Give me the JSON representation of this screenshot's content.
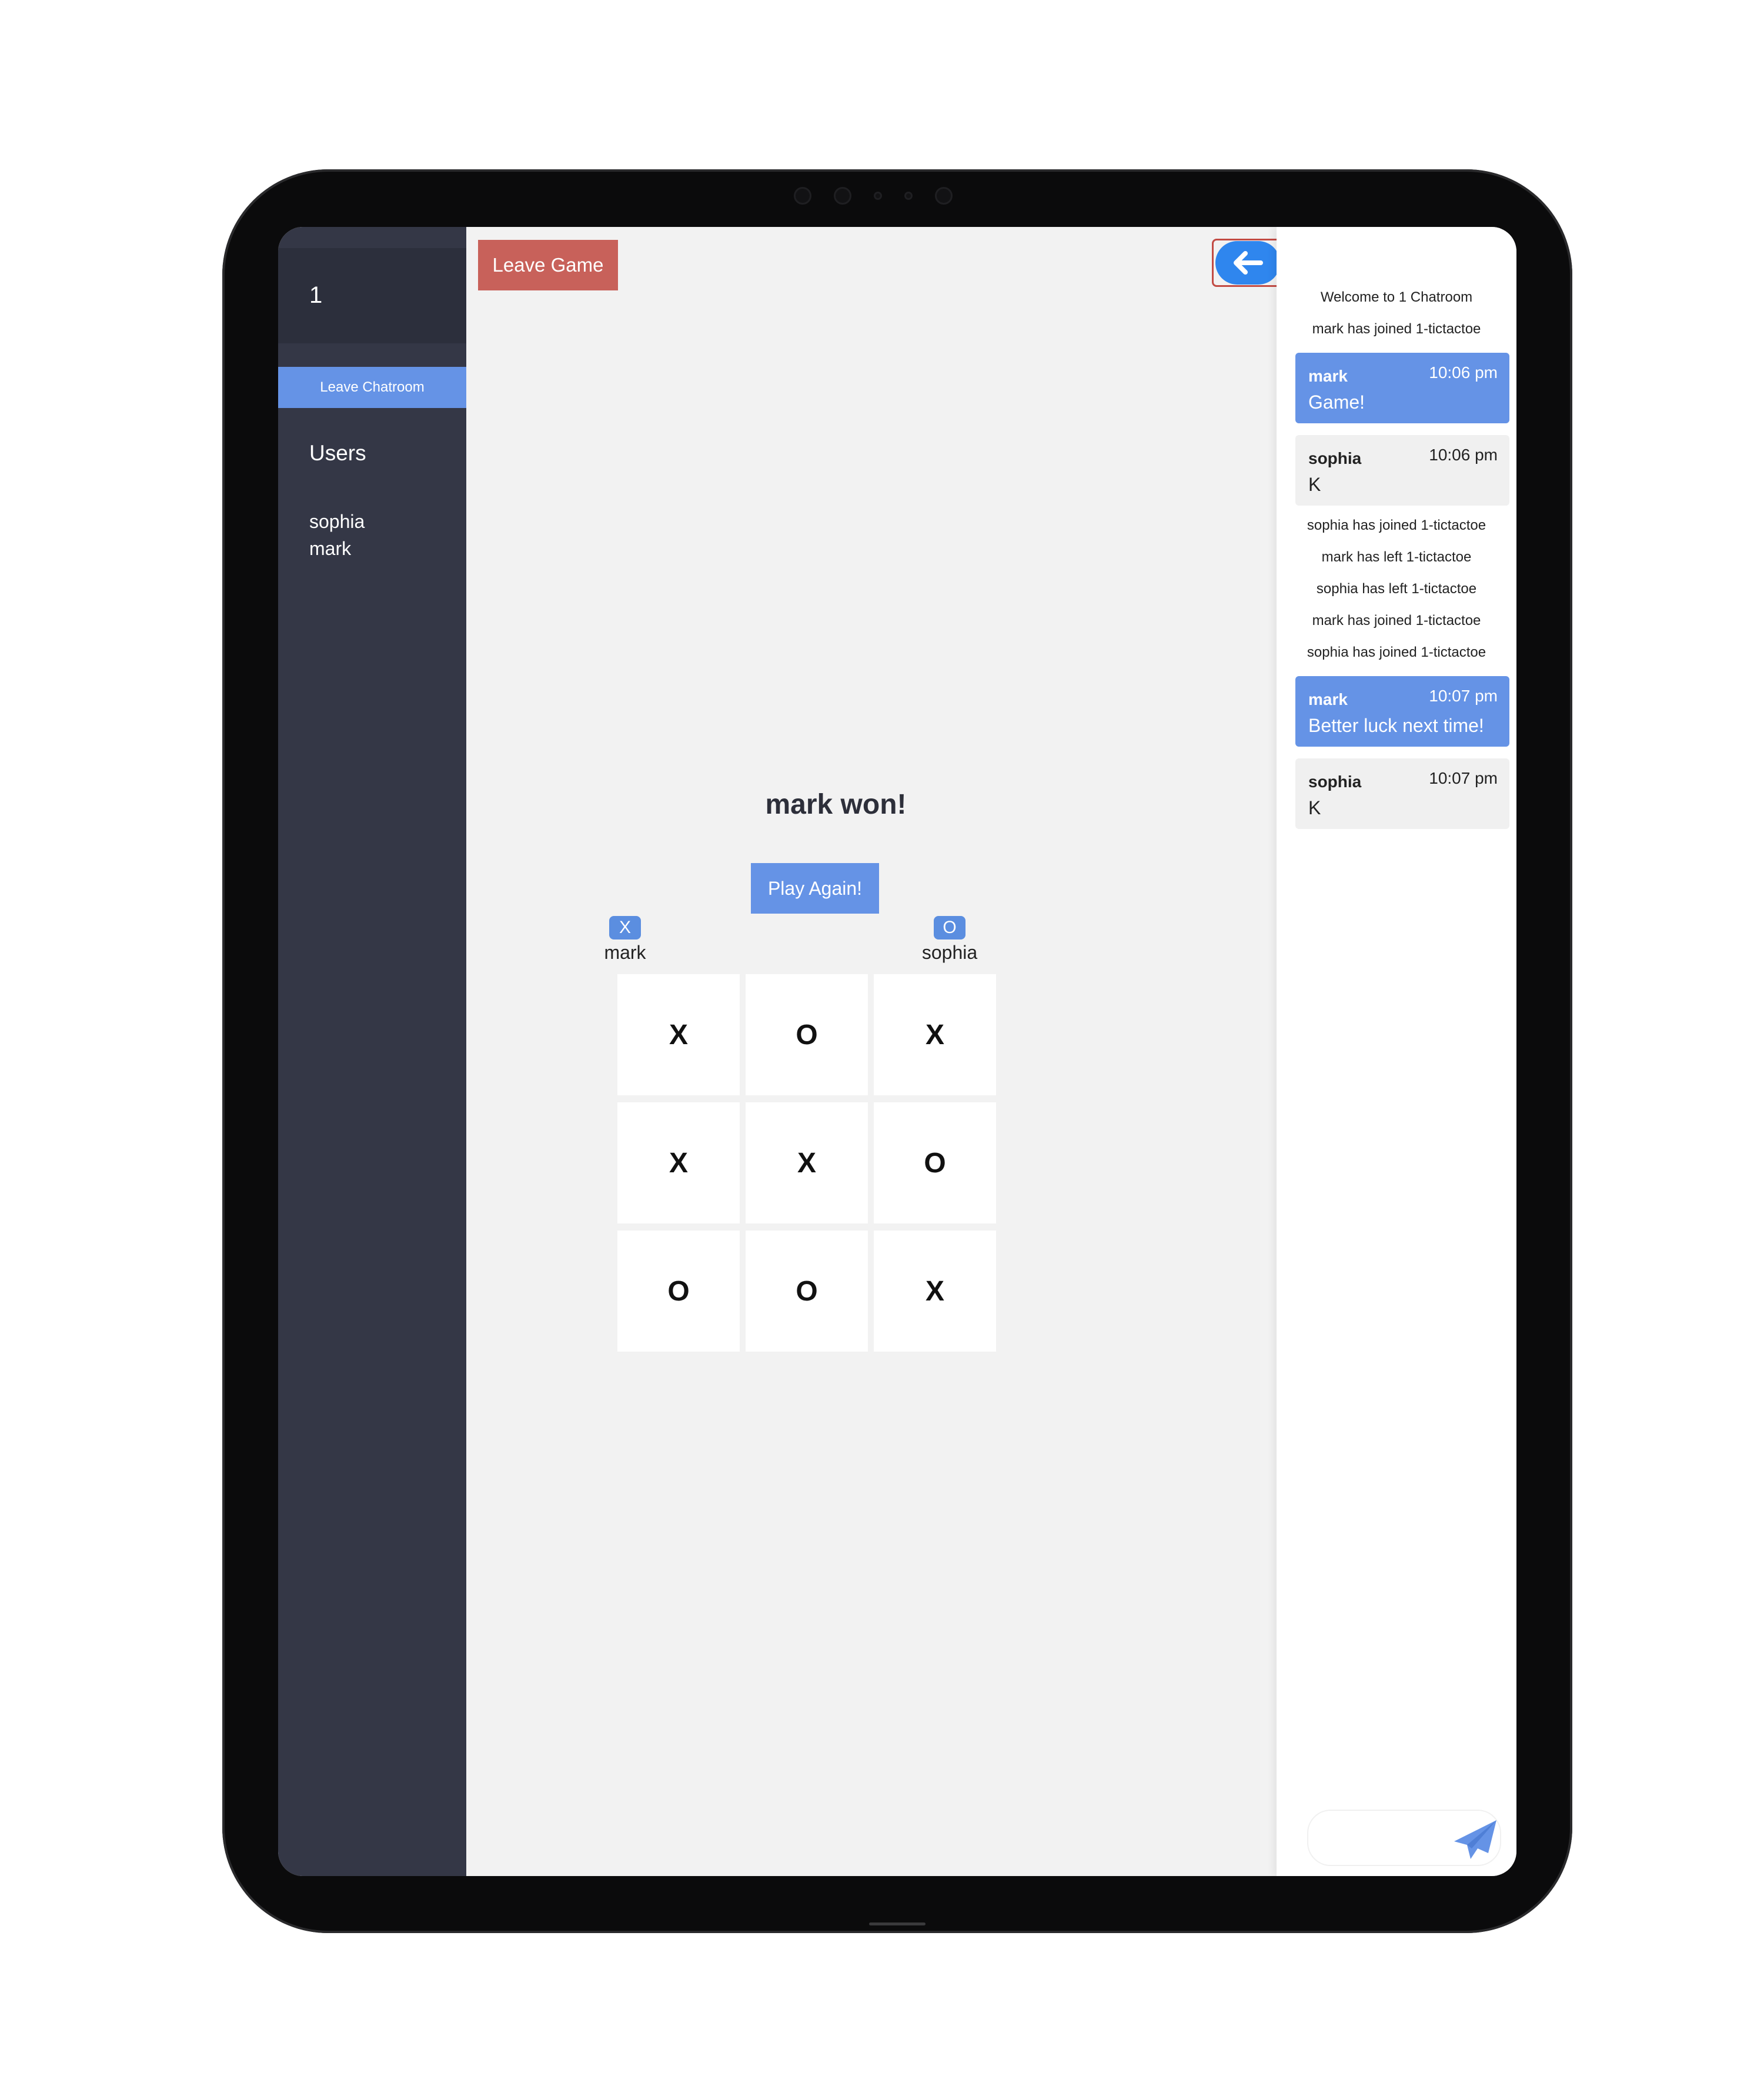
{
  "room": {
    "name": "1",
    "leave_chatroom_label": "Leave Chatroom",
    "users_title": "Users",
    "users": [
      "sophia",
      "mark"
    ]
  },
  "game": {
    "leave_game_label": "Leave Game",
    "back_icon": "arrow-left-icon",
    "result_text": "mark won!",
    "play_again_label": "Play Again!",
    "player_x": {
      "symbol": "X",
      "name": "mark"
    },
    "player_o": {
      "symbol": "O",
      "name": "sophia"
    },
    "board": [
      [
        "X",
        "O",
        "X"
      ],
      [
        "X",
        "X",
        "O"
      ],
      [
        "O",
        "O",
        "X"
      ]
    ]
  },
  "chat": {
    "system_top": [
      "Welcome to 1 Chatroom",
      "mark has joined 1-tictactoe"
    ],
    "messages": [
      {
        "author": "mark",
        "time": "10:06 pm",
        "text": "Game!"
      },
      {
        "author": "sophia",
        "time": "10:06 pm",
        "text": "K"
      },
      {
        "author": "mark",
        "time": "10:07 pm",
        "text": "Better luck next time!"
      },
      {
        "author": "sophia",
        "time": "10:07 pm",
        "text": "K"
      }
    ],
    "system_middle": [
      "sophia has joined 1-tictactoe",
      "mark has left 1-tictactoe",
      "sophia has left 1-tictactoe",
      "mark has joined 1-tictactoe",
      "sophia has joined 1-tictactoe"
    ],
    "input_value": "",
    "send_icon": "paper-plane-icon"
  },
  "colors": {
    "accent": "#6593e6",
    "danger": "#c8615a",
    "sidebar": "#343746",
    "back_button": "#2f86ee"
  }
}
